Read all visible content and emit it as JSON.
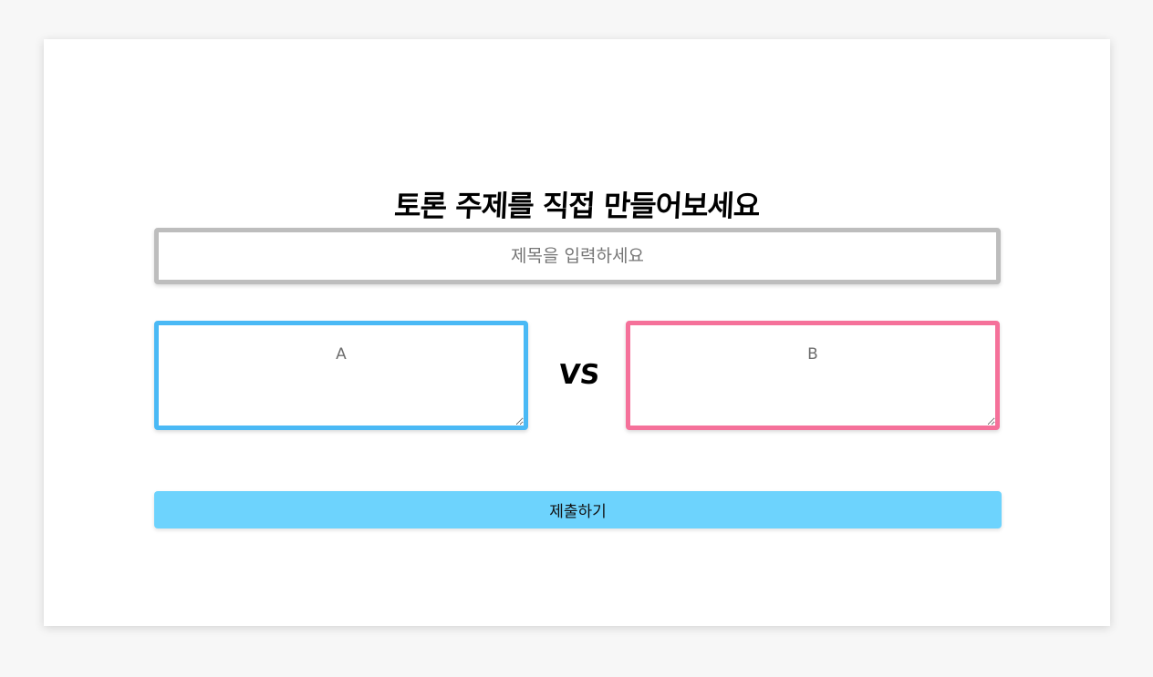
{
  "form": {
    "heading": "토론 주제를 직접 만들어보세요",
    "title_placeholder": "제목을 입력하세요",
    "option_a_placeholder": "A",
    "option_b_placeholder": "B",
    "vs_label": "VS",
    "submit_label": "제출하기"
  },
  "colors": {
    "option_a_border": "#4ab9f5",
    "option_b_border": "#f5719a",
    "title_border": "#bdbdbd",
    "submit_background": "#6dd3fd"
  }
}
